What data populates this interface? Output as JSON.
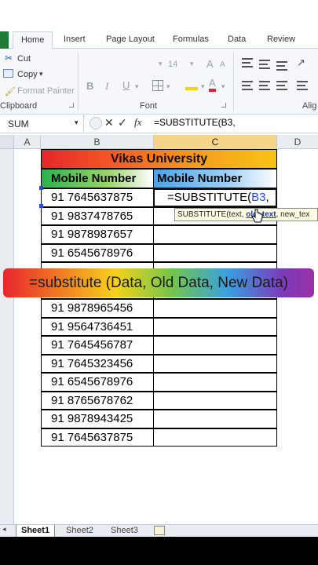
{
  "ribbon": {
    "tabs": [
      {
        "label": "Insert"
      },
      {
        "label": "Page Layout"
      },
      {
        "label": "Formulas"
      },
      {
        "label": "Data"
      },
      {
        "label": "Review"
      }
    ],
    "active_tab": "Home",
    "clipboard": {
      "cut": "Cut",
      "copy": "Copy",
      "copy_arrow": "▾",
      "format_painter": "Format Painter",
      "group": "Clipboard"
    },
    "font": {
      "size": "14",
      "bold": "B",
      "group": "Font"
    },
    "alignment_group": "Alig"
  },
  "formula_bar": {
    "name_box": "SUM",
    "fx": "fx",
    "formula": "=SUBSTITUTE(B3,"
  },
  "columns": [
    "A",
    "B",
    "C",
    "D"
  ],
  "table": {
    "title": "Vikas University",
    "header_b": "Mobile Number",
    "header_c": "Mobile Number",
    "rows": [
      "91 7645637875",
      "91 9837478765",
      "91 9878987657",
      "91 6545678976",
      "91 9878965456",
      "91 9564736451",
      "91 7645456787",
      "91 7645323456",
      "91 6545678976",
      "91 8765678762",
      "91 9878943425",
      "91 7645637875"
    ]
  },
  "active_cell": {
    "prefix": "=SUBSTITUTE(",
    "ref": "B3",
    "suffix": ","
  },
  "tooltip": {
    "prefix": "SUBSTITUTE(text, ",
    "bold": "old_text",
    "suffix": ", new_tex"
  },
  "banner": "=substitute (Data, Old Data, New Data)",
  "sheets": [
    "Sheet1",
    "Sheet2",
    "Sheet3"
  ],
  "colors": {
    "excel_green": "#1e7b36",
    "reference_blue": "#1f4fd6",
    "selected_col": "#f6d48a"
  }
}
